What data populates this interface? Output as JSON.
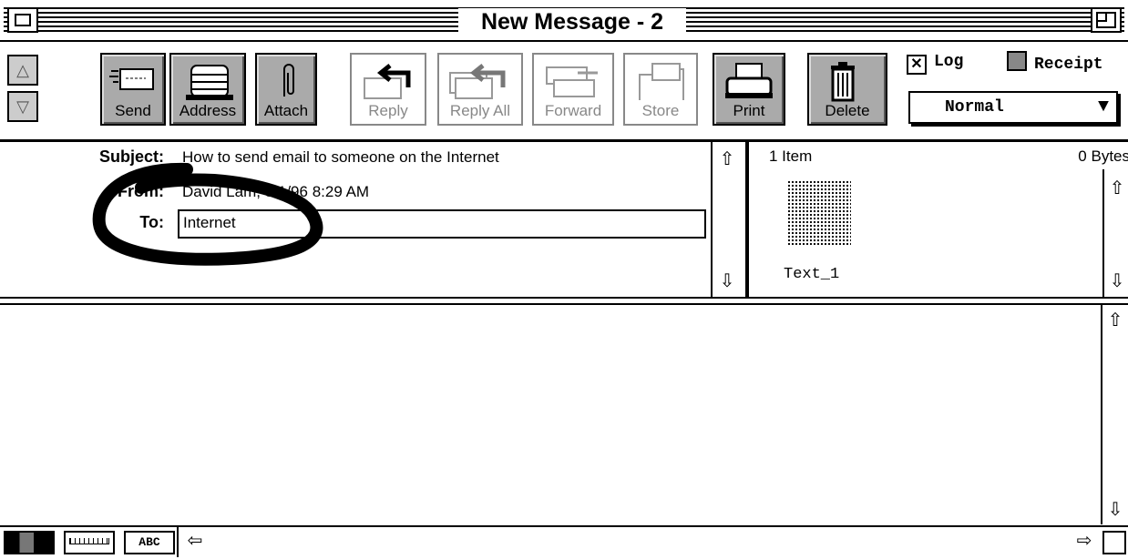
{
  "window": {
    "title": "New Message - 2"
  },
  "toolbar": {
    "buttons": [
      {
        "label": "Send",
        "enabled": true,
        "icon": "envelope-send-icon"
      },
      {
        "label": "Address",
        "enabled": true,
        "icon": "rolodex-icon"
      },
      {
        "label": "Attach",
        "enabled": true,
        "icon": "paperclip-icon"
      },
      {
        "label": "Reply",
        "enabled": false,
        "icon": "reply-arrow-icon"
      },
      {
        "label": "Reply All",
        "enabled": false,
        "icon": "reply-all-icon"
      },
      {
        "label": "Forward",
        "enabled": false,
        "icon": "forward-hand-icon"
      },
      {
        "label": "Store",
        "enabled": false,
        "icon": "folder-icon"
      },
      {
        "label": "Print",
        "enabled": true,
        "icon": "printer-icon"
      },
      {
        "label": "Delete",
        "enabled": true,
        "icon": "trash-can-icon"
      }
    ],
    "log": {
      "label": "Log",
      "checked": true,
      "mark": "✕"
    },
    "receipt": {
      "label": "Receipt",
      "checked": false
    },
    "priority": {
      "value": "Normal",
      "arrow": "▼"
    }
  },
  "header": {
    "subject_label": "Subject:",
    "subject_value": "How to send email to someone on the Internet",
    "from_label": "From:",
    "from_value": "David Lam, 8/1/96  8:29 AM",
    "to_label": "To:",
    "to_value": "Internet"
  },
  "attachments": {
    "count_text": "1 Item",
    "size_text": "0 Bytes",
    "items": [
      {
        "name": "Text_1",
        "icon": "text-document-icon"
      }
    ]
  },
  "scroll": {
    "up": "⇧",
    "down": "⇩",
    "left": "⇦",
    "right": "⇨"
  },
  "statusbar": {
    "abc_label": "ABC"
  },
  "annotation": {
    "shape": "hand-drawn-circle",
    "color": "#000000",
    "target": "to-field"
  }
}
